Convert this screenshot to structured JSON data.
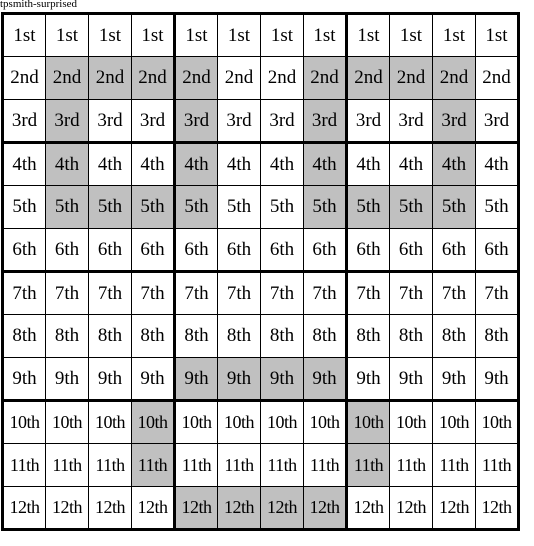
{
  "caption": "tpsmith-surprised",
  "grid": {
    "columns": 12,
    "column_block_size": 4,
    "row_block_size": 3,
    "shade_color": "#c0c0c0",
    "rows": [
      {
        "label": "1st",
        "shaded_columns": []
      },
      {
        "label": "2nd",
        "shaded_columns": [
          2,
          3,
          4,
          5,
          8,
          9,
          10,
          11
        ]
      },
      {
        "label": "3rd",
        "shaded_columns": [
          2,
          5,
          8,
          11
        ]
      },
      {
        "label": "4th",
        "shaded_columns": [
          2,
          5,
          8,
          11
        ]
      },
      {
        "label": "5th",
        "shaded_columns": [
          2,
          3,
          4,
          5,
          8,
          9,
          10,
          11
        ]
      },
      {
        "label": "6th",
        "shaded_columns": []
      },
      {
        "label": "7th",
        "shaded_columns": []
      },
      {
        "label": "8th",
        "shaded_columns": []
      },
      {
        "label": "9th",
        "shaded_columns": [
          5,
          6,
          7,
          8
        ]
      },
      {
        "label": "10th",
        "shaded_columns": [
          4,
          9
        ]
      },
      {
        "label": "11th",
        "shaded_columns": [
          4,
          9
        ]
      },
      {
        "label": "12th",
        "shaded_columns": [
          5,
          6,
          7,
          8
        ]
      }
    ]
  }
}
